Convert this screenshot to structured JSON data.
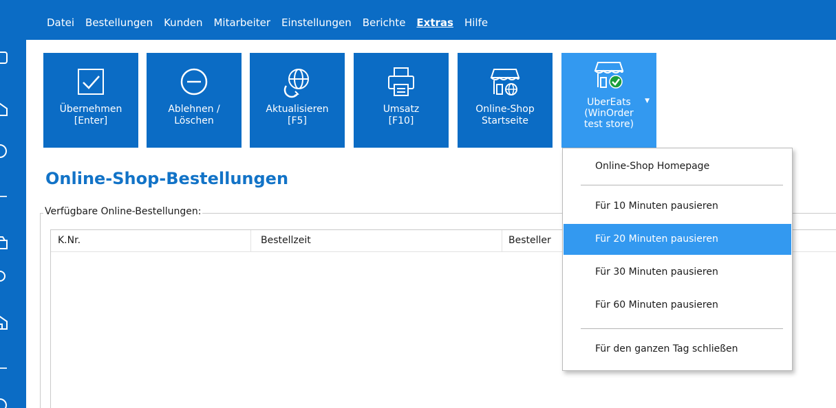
{
  "menu": [
    "Datei",
    "Bestellungen",
    "Kunden",
    "Mitarbeiter",
    "Einstellungen",
    "Berichte",
    "Extras",
    "Hilfe"
  ],
  "menu_active": "Extras",
  "toolbar": {
    "accept": {
      "line1": "Übernehmen",
      "line2": "[Enter]"
    },
    "reject": {
      "line1": "Ablehnen /",
      "line2": "Löschen"
    },
    "refresh": {
      "line1": "Aktualisieren",
      "line2": "[F5]"
    },
    "revenue": {
      "line1": "Umsatz",
      "line2": "[F10]"
    },
    "online_shop": {
      "line1": "Online-Shop",
      "line2": "Startseite"
    },
    "ubereats": {
      "line1": "UberEats",
      "line2": "(WinOrder",
      "line3": "test store)"
    }
  },
  "page_title": "Online-Shop-Bestellungen",
  "group_label": "Verfügbare Online-Bestellungen:",
  "table": {
    "columns": [
      "K.Nr.",
      "Bestellzeit",
      "Besteller"
    ],
    "rows": []
  },
  "dropdown": {
    "items": [
      {
        "label": "Online-Shop Homepage",
        "selected": false
      },
      {
        "label": "Für 10 Minuten pausieren",
        "selected": false
      },
      {
        "label": "Für 20 Minuten pausieren",
        "selected": true
      },
      {
        "label": "Für 30 Minuten pausieren",
        "selected": false
      },
      {
        "label": "Für 60 Minuten pausieren",
        "selected": false
      },
      {
        "label": "Für den ganzen Tag schließen",
        "selected": false
      }
    ]
  },
  "colors": {
    "brand_blue": "#0b6cc5",
    "highlight_blue": "#3399f0",
    "title_blue": "#1273c7",
    "status_green": "#1a9e3b"
  }
}
